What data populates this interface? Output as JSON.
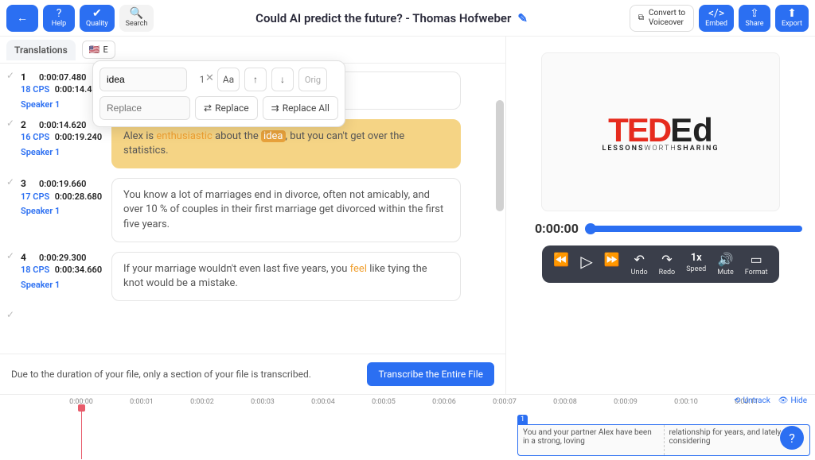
{
  "topbar": {
    "back": "",
    "help": "Help",
    "quality": "Quality",
    "search": "Search",
    "title": "Could AI predict the future? - Thomas Hofweber",
    "convert": "Convert to\nVoiceover",
    "embed": "Embed",
    "share": "Share",
    "export": "Export"
  },
  "tabs": {
    "translations": "Translations",
    "lang_flag": "🇺🇸",
    "lang_label": "E"
  },
  "find": {
    "search_value": "idea",
    "replace_placeholder": "Replace",
    "count": "1",
    "case": "Aa",
    "orig": "Orig",
    "replace_btn": "Replace",
    "replace_all_btn": "Replace All"
  },
  "subs": [
    {
      "num": "1",
      "tc_in": "0:00:07.480",
      "tc_out": "0:00:14.400",
      "cps": "18 CPS",
      "speaker": "Speaker 1",
      "text_post": " relationship for years, and lately"
    },
    {
      "num": "2",
      "tc_in": "0:00:14.620",
      "tc_out": "0:00:19.240",
      "cps": "16 CPS",
      "speaker": "Speaker 1",
      "text_pre": "Alex is ",
      "hl1": "enthusiastic",
      "text_mid": " about the ",
      "match": "idea",
      "text_post2": ", but you can't get over the statistics."
    },
    {
      "num": "3",
      "tc_in": "0:00:19.660",
      "tc_out": "0:00:28.680",
      "cps": "17 CPS",
      "speaker": "Speaker 1",
      "text": "You know a lot of marriages end in divorce, often not amicably, and over 10 % of couples in their first marriage get divorced within the first five years."
    },
    {
      "num": "4",
      "tc_in": "0:00:29.300",
      "tc_out": "0:00:34.660",
      "cps": "18 CPS",
      "speaker": "Speaker 1",
      "text_pre": "If your marriage wouldn't even last five years, you ",
      "hl1": "feel",
      "text_post": " like tying the knot would be a mistake."
    }
  ],
  "notice": {
    "text": "Due to the duration of your file, only a section of your file is transcribed.",
    "btn": "Transcribe the Entire File"
  },
  "video": {
    "ted": "TED",
    "ed": "Ed",
    "tag_pre": "LESSONS",
    "tag_mid": "WORTH",
    "tag_post": "SHARING",
    "time": "0:00:00",
    "undo": "Undo",
    "redo": "Redo",
    "speed_val": "1x",
    "speed": "Speed",
    "mute": "Mute",
    "format": "Format"
  },
  "timeline": {
    "ticks": [
      "0:00:00",
      "0:00:01",
      "0:00:02",
      "0:00:03",
      "0:00:04",
      "0:00:05",
      "0:00:06",
      "0:00:07",
      "0:00:08",
      "0:00:09",
      "0:00:10",
      "0:00:11"
    ],
    "untrack": "Untrack",
    "hide": "Hide",
    "block_num": "1",
    "cell1": "You and your partner Alex have been in a strong, loving",
    "cell2": "relationship for years, and lately you considering"
  }
}
